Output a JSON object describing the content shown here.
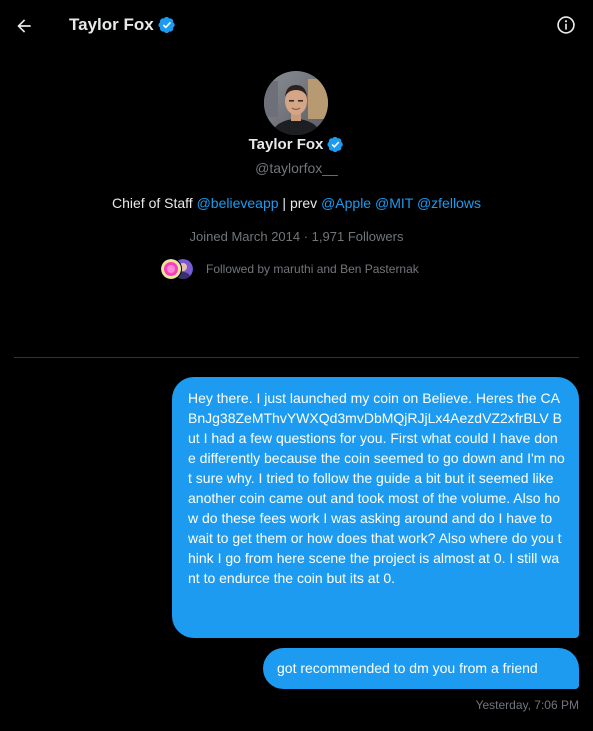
{
  "header": {
    "back_icon": "arrow-left-icon",
    "title": "Taylor Fox",
    "verified_icon": "verified-badge-icon",
    "info_icon": "info-circle-icon"
  },
  "profile": {
    "name": "Taylor Fox",
    "handle": "@taylorfox__",
    "bio": {
      "prefix": "Chief of Staff ",
      "mention_1": "@believeapp",
      "separator": " | prev ",
      "mention_2": "@Apple",
      "space_1": " ",
      "mention_3": "@MIT",
      "space_2": " ",
      "mention_4": "@zfellows"
    },
    "meta": "Joined March 2014 · 1,971 Followers",
    "followed_by": "Followed by maruthi and Ben Pasternak"
  },
  "messages": [
    {
      "text": "Hey there. I just launched my coin on Believe. Heres the CA BnJg38ZeMThvYWXQd3mvDbMQjRJjLx4AezdVZ2xfrBLV But I had a few questions for you. First what could I have done differently because the coin seemed to go down and I'm not sure why. I tried to follow the guide a bit but it seemed like another coin came out and took most of the volume. Also how do these fees work I was asking around and do I have to wait to get them or how does that work? Also where do you think I go from here scene the project is almost at 0. I still want to endurce the coin but its at 0."
    },
    {
      "text": "got recommended to dm you from a friend"
    }
  ],
  "timestamp": "Yesterday, 7:06 PM",
  "colors": {
    "background": "#000000",
    "accent": "#1d9bf0",
    "text_primary": "#e7e9ea",
    "text_secondary": "#71767b"
  }
}
